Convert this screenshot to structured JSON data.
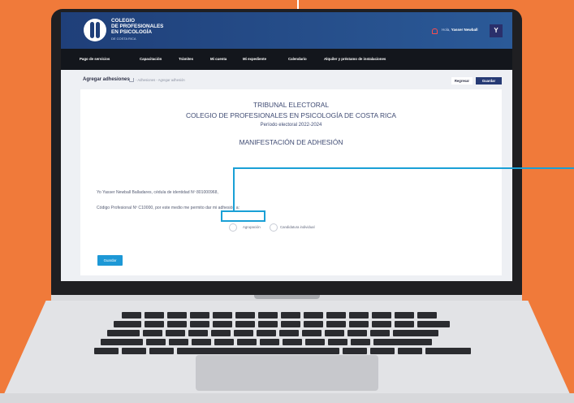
{
  "header": {
    "org_name": "COLEGIO\nDE PROFESIONALES\nEN PSICOLOGÍA",
    "org_sub": "DE COSTA RICA",
    "greeting": "Hola,",
    "user_name": "Yasser Newball",
    "avatar_letter": "Y"
  },
  "nav": {
    "items": [
      "Pago de servicios",
      "Capacitación",
      "Trámites",
      "Mi cuenta",
      "Mi expediente",
      "Calendario",
      "Alquiler y préstamo de instalaciones"
    ]
  },
  "breadcrumb": {
    "title": "Agregar adhesiones",
    "path": "- Adhesiones - Agregar adhesión",
    "back_label": "Regresar",
    "save_label": "Guardar"
  },
  "form": {
    "title1": "TRIBUNAL ELECTORAL",
    "title2": "COLEGIO DE PROFESIONALES EN PSICOLOGÍA DE COSTA RICA",
    "period": "Período electoral 2022-2024",
    "heading": "MANIFESTACIÓN DE ADHESIÓN",
    "para1": "Yo Yasser Newball Balladares, cédula de identidad Nº 801000968,",
    "para2": "Código Profesional Nº C10000, por este medio me permito dar mi adhesión a:",
    "option1": "Agrupación",
    "option2": "Candidatura individual",
    "save_label": "Guardar"
  },
  "colors": {
    "background": "#f07a3a",
    "header_blue": "#1f3f79",
    "nav_dark": "#13161c",
    "highlight": "#1aa0d6",
    "save_button": "#1d98d6"
  }
}
